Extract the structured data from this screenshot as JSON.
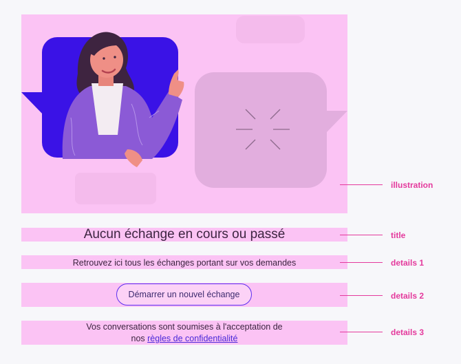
{
  "empty_state": {
    "title": "Aucun échange en cours ou passé",
    "details_1": "Retrouvez ici tous les échanges portant sur vos demandes",
    "cta_label": "Démarrer un nouvel échange",
    "details_3_line1": "Vos conversations sont soumises à l'acceptation de",
    "details_3_prefix": "nos ",
    "details_3_link": "règles de confidentialité"
  },
  "annotations": {
    "illustration": "illustration",
    "title": "title",
    "details_1": "details 1",
    "details_2": "details 2",
    "details_3": "details 3"
  },
  "colors": {
    "band": "#fbc3f4",
    "annotation": "#e4399c",
    "accent": "#5b2df0",
    "bubble_left": "#3a12e6",
    "bubble_right": "#e2aede"
  }
}
